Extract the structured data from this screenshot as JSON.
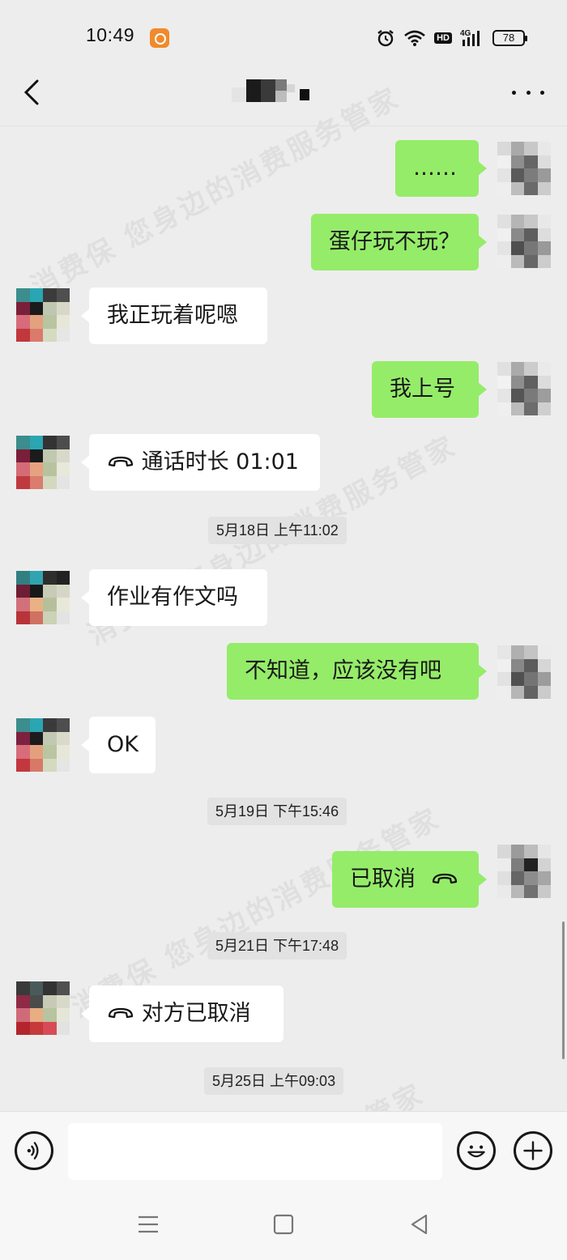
{
  "status_bar": {
    "time": "10:49",
    "network": "4G",
    "hd_label": "HD",
    "battery": "78",
    "icons": [
      "app-notification-icon",
      "alarm-icon",
      "wifi-icon",
      "hd-icon",
      "signal-icon",
      "battery-icon"
    ]
  },
  "header": {
    "back_icon": "chevron-left-icon",
    "title": "",
    "more_icon": "more-dots-icon"
  },
  "messages": [
    {
      "side": "out",
      "text": "……"
    },
    {
      "side": "out",
      "text": "蛋仔玩不玩？"
    },
    {
      "side": "in",
      "text": "我正玩着呢嗯"
    },
    {
      "side": "out",
      "text": "我上号"
    },
    {
      "side": "in",
      "type": "call",
      "text": "通话时长 01:01",
      "icon": "phone-hangup-icon"
    },
    {
      "side": "in",
      "text": "作业有作文吗"
    },
    {
      "side": "out",
      "text": "不知道，应该没有吧"
    },
    {
      "side": "in",
      "text": "OK"
    },
    {
      "side": "out",
      "type": "call",
      "text": "已取消",
      "icon": "phone-hangup-icon"
    },
    {
      "side": "in",
      "type": "call",
      "text": "对方已取消",
      "icon": "phone-hangup-icon"
    }
  ],
  "timestamps": [
    "5月18日 上午11:02",
    "5月19日 下午15:46",
    "5月21日 下午17:48",
    "5月25日 上午09:03"
  ],
  "watermark": "消费保 您身边的消费服务管家",
  "input_bar": {
    "voice_icon": "voice-input-icon",
    "input_value": "",
    "emoji_icon": "emoji-icon",
    "plus_icon": "plus-icon"
  },
  "nav_bar": [
    "menu-icon",
    "home-icon",
    "back-triangle-icon"
  ],
  "colors": {
    "background": "#ededed",
    "outgoing_bubble": "#95ec69",
    "incoming_bubble": "#ffffff",
    "timestamp_bg": "#e2e2e2"
  }
}
